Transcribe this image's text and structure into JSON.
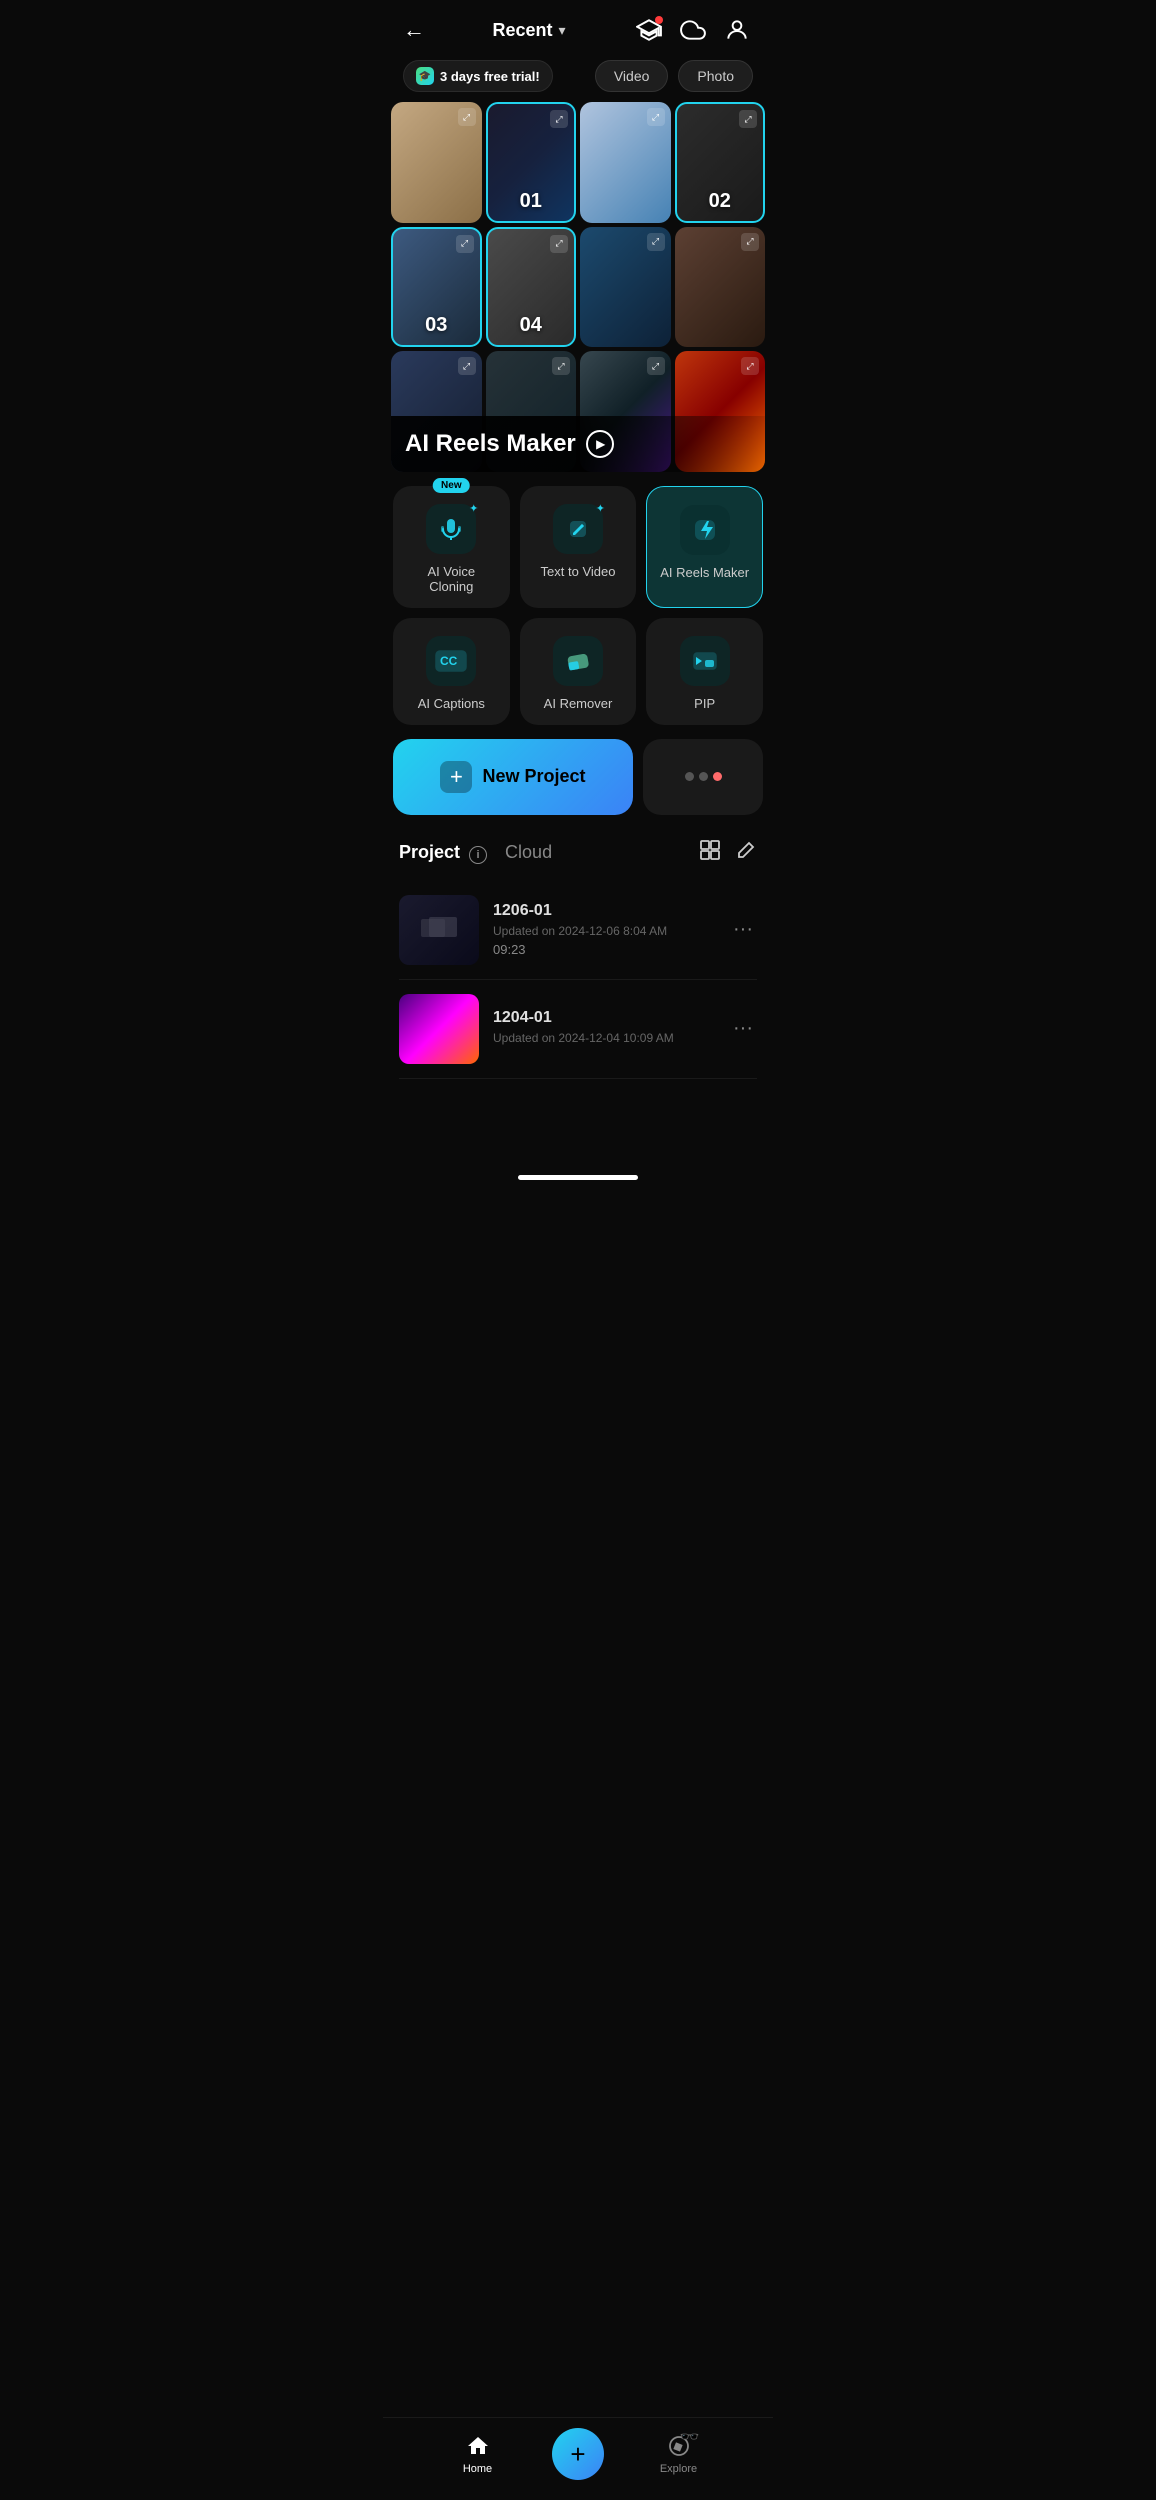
{
  "header": {
    "back_label": "←",
    "title": "Recent",
    "dropdown_icon": "▾"
  },
  "trial_badge": {
    "label": "3 days free trial!",
    "icon": "🎓"
  },
  "tabs": {
    "video": "Video",
    "photo": "Photo"
  },
  "thumbnails_row1": [
    {
      "id": "t1",
      "color_class": "c1",
      "number": "",
      "highlighted": false
    },
    {
      "id": "t2",
      "color_class": "c2",
      "number": "01",
      "highlighted": true
    },
    {
      "id": "t3",
      "color_class": "c3",
      "number": "",
      "highlighted": false
    },
    {
      "id": "t4",
      "color_class": "c4",
      "number": "02",
      "highlighted": true
    }
  ],
  "thumbnails_row2": [
    {
      "id": "t5",
      "color_class": "c5",
      "number": "03",
      "highlighted": true
    },
    {
      "id": "t6",
      "color_class": "c6",
      "number": "04",
      "highlighted": true
    },
    {
      "id": "t7",
      "color_class": "c7",
      "number": "",
      "highlighted": false
    },
    {
      "id": "t8",
      "color_class": "c8",
      "number": "",
      "highlighted": false
    }
  ],
  "thumbnails_row3": [
    {
      "id": "t9",
      "color_class": "c9",
      "number": "",
      "highlighted": false
    },
    {
      "id": "t10",
      "color_class": "c10",
      "number": "",
      "highlighted": false
    },
    {
      "id": "t11",
      "color_class": "c11",
      "number": "",
      "highlighted": false
    },
    {
      "id": "t12",
      "color_class": "c12",
      "number": "",
      "highlighted": false
    }
  ],
  "reels_banner": {
    "title": "AI Reels Maker",
    "play_icon": "▶"
  },
  "tools": [
    {
      "id": "ai-voice",
      "label": "AI Voice Cloning",
      "icon_type": "voice",
      "highlighted": false,
      "new_badge": true,
      "badge_label": "New"
    },
    {
      "id": "text-to-video",
      "label": "Text  to Video",
      "icon_type": "pencil",
      "highlighted": false,
      "new_badge": false
    },
    {
      "id": "ai-reels",
      "label": "AI Reels Maker",
      "icon_type": "lightning",
      "highlighted": true,
      "new_badge": false
    },
    {
      "id": "ai-captions",
      "label": "AI Captions",
      "icon_type": "cc",
      "highlighted": false,
      "new_badge": false
    },
    {
      "id": "ai-remover",
      "label": "AI Remover",
      "icon_type": "eraser",
      "highlighted": false,
      "new_badge": false
    },
    {
      "id": "pip",
      "label": "PIP",
      "icon_type": "pip",
      "highlighted": false,
      "new_badge": false
    }
  ],
  "new_project": {
    "label": "New Project",
    "plus_icon": "+"
  },
  "more_dots": {
    "dots": [
      "inactive",
      "inactive",
      "active"
    ]
  },
  "project_section": {
    "tab_project": "Project",
    "tab_cloud": "Cloud",
    "info_icon": "i"
  },
  "projects": [
    {
      "id": "proj1",
      "name": "1206-01",
      "date": "Updated on 2024-12-06 8:04 AM",
      "duration": "09:23",
      "color_class": "proj1-bg"
    },
    {
      "id": "proj2",
      "name": "1204-01",
      "date": "Updated on 2024-12-04 10:09 AM",
      "duration": "",
      "color_class": "proj2-bg"
    }
  ],
  "bottom_nav": {
    "home_label": "Home",
    "explore_label": "Explore",
    "add_icon": "+"
  }
}
